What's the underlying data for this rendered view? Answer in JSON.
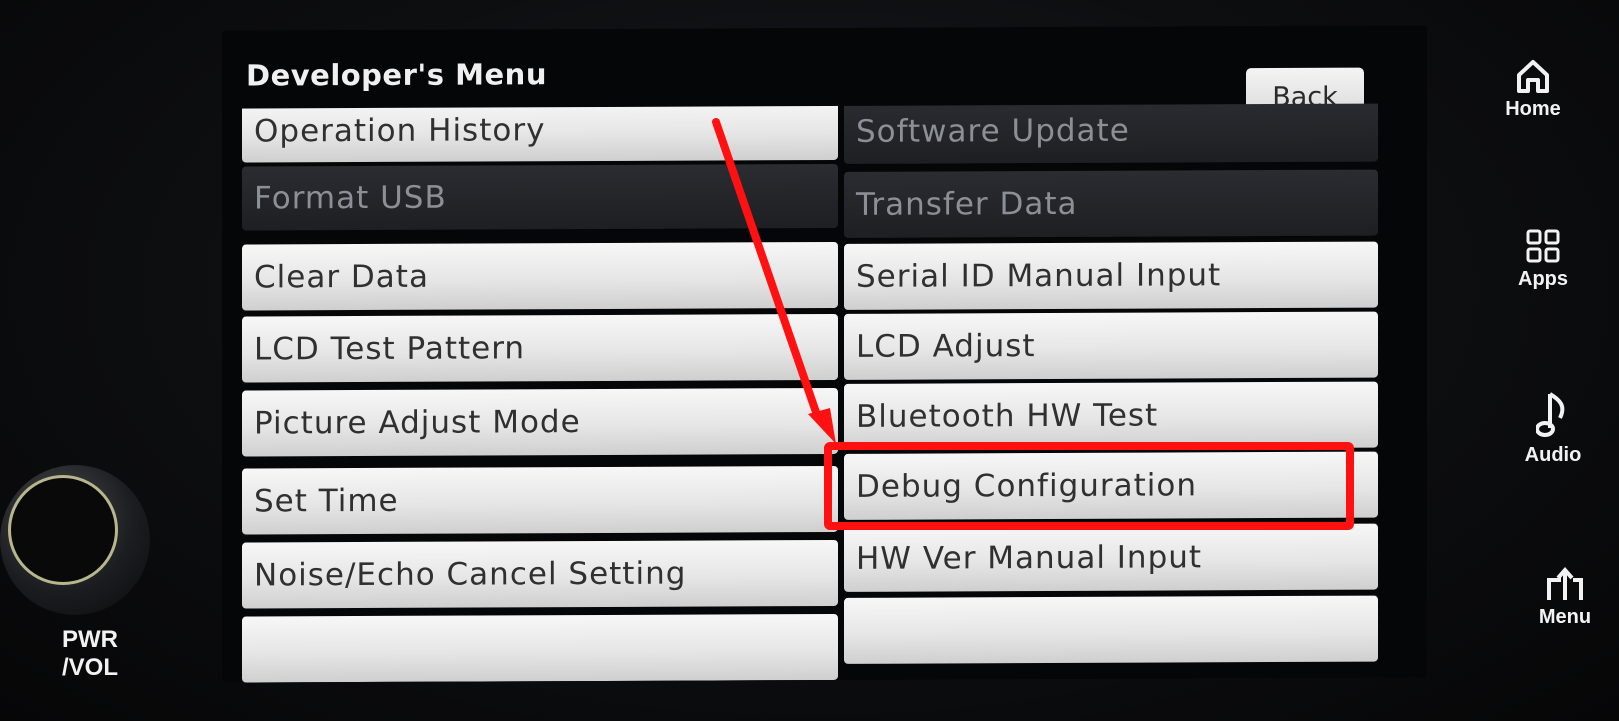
{
  "screen": {
    "title": "Developer's Menu",
    "back_label": "Back"
  },
  "menu": {
    "left": [
      {
        "label": "Operation History",
        "enabled": true
      },
      {
        "label": "Format USB",
        "enabled": false
      },
      {
        "label": "Clear Data",
        "enabled": true
      },
      {
        "label": "LCD Test Pattern",
        "enabled": true
      },
      {
        "label": "Picture Adjust Mode",
        "enabled": true
      },
      {
        "label": "Set Time",
        "enabled": true
      },
      {
        "label": "Noise/Echo Cancel Setting",
        "enabled": true
      }
    ],
    "right": [
      {
        "label": "Software Update",
        "enabled": false
      },
      {
        "label": "Transfer Data",
        "enabled": false
      },
      {
        "label": "Serial ID Manual Input",
        "enabled": true
      },
      {
        "label": "LCD Adjust",
        "enabled": true
      },
      {
        "label": "Bluetooth HW Test",
        "enabled": true
      },
      {
        "label": "Debug Configuration",
        "enabled": true
      },
      {
        "label": "HW Ver Manual Input",
        "enabled": true
      }
    ]
  },
  "hardware": {
    "home_label": "Home",
    "apps_label": "Apps",
    "audio_label": "Audio",
    "menu_label": "Menu",
    "pwr_line1": "PWR",
    "pwr_line2": "/VOL"
  },
  "annotation": {
    "color": "#ff1111",
    "target": "Debug Configuration"
  }
}
